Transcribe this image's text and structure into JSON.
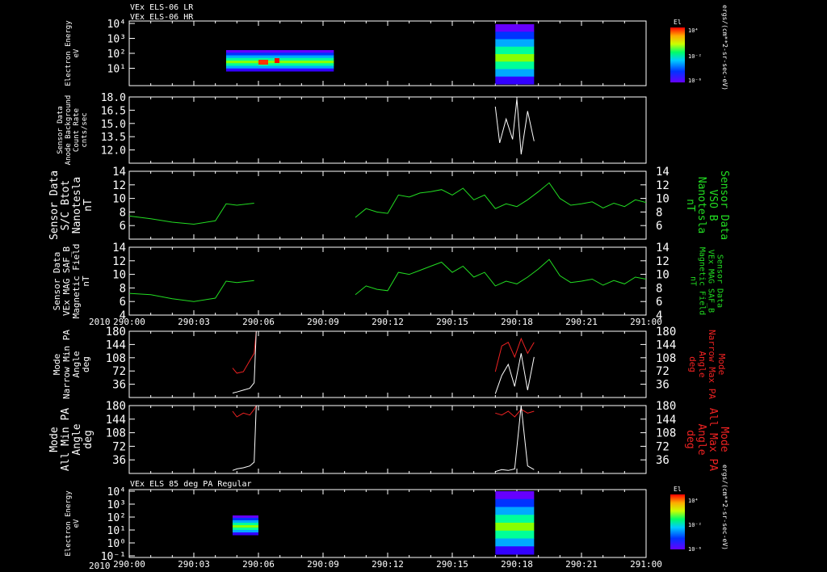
{
  "titles": {
    "panel1": [
      "VEx ELS-06 LR",
      "VEx ELS-06 HR"
    ],
    "panel7": "VEx ELS 85 deg PA Regular"
  },
  "year_label": "2010",
  "colors": {
    "white": "#ffffff",
    "green": "#22dd22",
    "red": "#ee2222",
    "background": "#000000"
  },
  "colorbar": {
    "top_title": "El",
    "bottom_title": "El",
    "tick_labels": [
      "10⁴",
      "10⁻²",
      "10⁻⁶"
    ],
    "unit_label": "ergs/(cm**2-sr-sec-eV)"
  },
  "chart_data": [
    {
      "type": "heatmap",
      "name": "electron-energy-spectrogram",
      "title": "VEx ELS-06 LR / VEx ELS-06 HR",
      "ylabel": [
        "Electron Energy",
        "eV"
      ],
      "yscale": "log",
      "ylim": [
        1,
        10000
      ],
      "yticks": [
        "10⁴",
        "10³",
        "10²",
        "10¹"
      ],
      "x_range": [
        "290:00",
        "291:00"
      ],
      "data_intervals": [
        [
          "290:04.5",
          "290:09.5"
        ],
        [
          "290:17.0",
          "290:18.8"
        ]
      ]
    },
    {
      "type": "line",
      "name": "anode-background-count-rate",
      "ylabel": [
        "Sensor Data",
        "Anode Background",
        "Count Rate",
        "cnts/sec"
      ],
      "ylim": [
        10.5,
        18.0
      ],
      "yticks": [
        "18.0",
        "16.5",
        "15.0",
        "13.5",
        "12.0"
      ],
      "series": [
        {
          "color": "white",
          "x": [
            17.0,
            17.2,
            17.5,
            17.8,
            18.0,
            18.2,
            18.5,
            18.8
          ],
          "y": [
            16.9,
            12.8,
            15.5,
            13.2,
            17.8,
            11.5,
            16.4,
            13.0
          ]
        }
      ]
    },
    {
      "type": "line",
      "name": "sc-btot",
      "ylabel": [
        "Sensor Data",
        "S/C Btot",
        "Nanotesla",
        "nT"
      ],
      "ylabel_right": [
        "Sensor Data",
        "VSO B",
        "Nanotesla",
        "nT"
      ],
      "ylim": [
        4,
        14
      ],
      "yticks": [
        "14",
        "12",
        "10",
        "8",
        "6"
      ],
      "series": [
        {
          "color": "green",
          "x": [
            0,
            1,
            2,
            3,
            4,
            4.5,
            5,
            5.8
          ],
          "y": [
            7.4,
            7.0,
            6.5,
            6.2,
            6.7,
            9.2,
            9.0,
            9.3
          ]
        },
        {
          "color": "green",
          "x": [
            10.5,
            11,
            11.5,
            12,
            12.5,
            13,
            13.5,
            14,
            14.5,
            15,
            15.5,
            16,
            16.5,
            17,
            17.5,
            18,
            18.5,
            19,
            19.5,
            20,
            20.5,
            21,
            21.5,
            22,
            22.5,
            23,
            23.5,
            24
          ],
          "y": [
            7.2,
            8.5,
            8.0,
            7.8,
            10.5,
            10.2,
            10.8,
            11.0,
            11.3,
            10.5,
            11.5,
            9.8,
            10.5,
            8.5,
            9.2,
            8.8,
            9.8,
            11.0,
            12.3,
            10.0,
            9.0,
            9.2,
            9.5,
            8.6,
            9.3,
            8.8,
            9.8,
            9.4
          ]
        }
      ]
    },
    {
      "type": "line",
      "name": "vex-mag-saf-b",
      "ylabel": [
        "Sensor Data",
        "VEx MAG SAF_B",
        "Magnetic Field",
        "nT"
      ],
      "ylabel_right": [
        "Sensor Data",
        "VEx MAG SAF_B",
        "Magnetic Field",
        "nT"
      ],
      "ylim": [
        4,
        14
      ],
      "yticks": [
        "14",
        "12",
        "10",
        "8",
        "6",
        "4"
      ],
      "series": [
        {
          "color": "green",
          "x": [
            0,
            1,
            2,
            3,
            4,
            4.5,
            5,
            5.8
          ],
          "y": [
            7.2,
            7.0,
            6.4,
            6.0,
            6.5,
            9.0,
            8.8,
            9.1
          ]
        },
        {
          "color": "green",
          "x": [
            10.5,
            11,
            11.5,
            12,
            12.5,
            13,
            13.5,
            14,
            14.5,
            15,
            15.5,
            16,
            16.5,
            17,
            17.5,
            18,
            18.5,
            19,
            19.5,
            20,
            20.5,
            21,
            21.5,
            22,
            22.5,
            23,
            23.5,
            24
          ],
          "y": [
            7.0,
            8.3,
            7.8,
            7.6,
            10.3,
            10.0,
            10.6,
            11.2,
            11.8,
            10.3,
            11.2,
            9.6,
            10.3,
            8.3,
            9.0,
            8.6,
            9.6,
            10.8,
            12.2,
            9.8,
            8.8,
            9.0,
            9.3,
            8.4,
            9.1,
            8.6,
            9.6,
            9.3
          ]
        }
      ],
      "x_tick_labels": [
        "290:00",
        "290:03",
        "290:06",
        "290:09",
        "290:12",
        "290:15",
        "290:18",
        "290:21",
        "291:00"
      ]
    },
    {
      "type": "line",
      "name": "narrow-pitch-angle",
      "ylabel": [
        "Mode",
        "Narrow Min PA",
        "Angle",
        "deg"
      ],
      "ylabel_right": [
        "Mode",
        "Narrow Max PA",
        "Angle",
        "deg"
      ],
      "ylim": [
        0,
        180
      ],
      "yticks": [
        "180",
        "144",
        "108",
        "72",
        "36"
      ],
      "series": [
        {
          "color": "red",
          "x": [
            4.8,
            5.0,
            5.3,
            5.6,
            5.8,
            5.9
          ],
          "y": [
            80,
            66,
            70,
            100,
            120,
            180
          ]
        },
        {
          "color": "white",
          "x": [
            4.8,
            5.0,
            5.3,
            5.6,
            5.8,
            5.9
          ],
          "y": [
            12,
            15,
            20,
            25,
            40,
            180
          ]
        },
        {
          "color": "red",
          "x": [
            17.0,
            17.3,
            17.6,
            17.9,
            18.2,
            18.5,
            18.8
          ],
          "y": [
            70,
            140,
            150,
            110,
            160,
            120,
            150
          ]
        },
        {
          "color": "white",
          "x": [
            17.0,
            17.3,
            17.6,
            17.9,
            18.2,
            18.5,
            18.8
          ],
          "y": [
            10,
            60,
            90,
            30,
            120,
            20,
            110
          ]
        }
      ]
    },
    {
      "type": "line",
      "name": "all-pitch-angle",
      "ylabel": [
        "Mode",
        "All Min PA",
        "Angle",
        "deg"
      ],
      "ylabel_right": [
        "Mode",
        "All Max PA",
        "Angle",
        "deg"
      ],
      "ylim": [
        0,
        180
      ],
      "yticks": [
        "180",
        "144",
        "108",
        "72",
        "36"
      ],
      "series": [
        {
          "color": "red",
          "x": [
            4.8,
            5.0,
            5.3,
            5.6,
            5.8,
            5.9
          ],
          "y": [
            165,
            150,
            160,
            155,
            170,
            180
          ]
        },
        {
          "color": "white",
          "x": [
            4.8,
            5.0,
            5.3,
            5.6,
            5.8,
            5.9
          ],
          "y": [
            8,
            12,
            15,
            20,
            30,
            180
          ]
        },
        {
          "color": "red",
          "x": [
            17.0,
            17.3,
            17.6,
            17.9,
            18.2,
            18.5,
            18.8
          ],
          "y": [
            160,
            155,
            165,
            150,
            170,
            160,
            165
          ]
        },
        {
          "color": "white",
          "x": [
            17.0,
            17.3,
            17.6,
            17.9,
            18.2,
            18.5,
            18.8
          ],
          "y": [
            5,
            10,
            8,
            12,
            180,
            20,
            10
          ]
        }
      ]
    },
    {
      "type": "heatmap",
      "name": "electron-energy-85deg",
      "title": "VEx ELS 85 deg PA Regular",
      "ylabel": [
        "Electron Energy",
        "eV"
      ],
      "yscale": "log",
      "ylim": [
        1,
        10000
      ],
      "yticks": [
        "10⁴",
        "10³",
        "10²",
        "10¹",
        "10⁰",
        "10⁻¹"
      ],
      "x_range": [
        "290:00",
        "291:00"
      ],
      "data_intervals": [
        [
          "290:04.8",
          "290:06.0"
        ],
        [
          "290:17.0",
          "290:18.8"
        ]
      ],
      "x_tick_labels": [
        "290:00",
        "290:03",
        "290:06",
        "290:09",
        "290:12",
        "290:15",
        "290:18",
        "290:21",
        "291:00"
      ]
    }
  ]
}
